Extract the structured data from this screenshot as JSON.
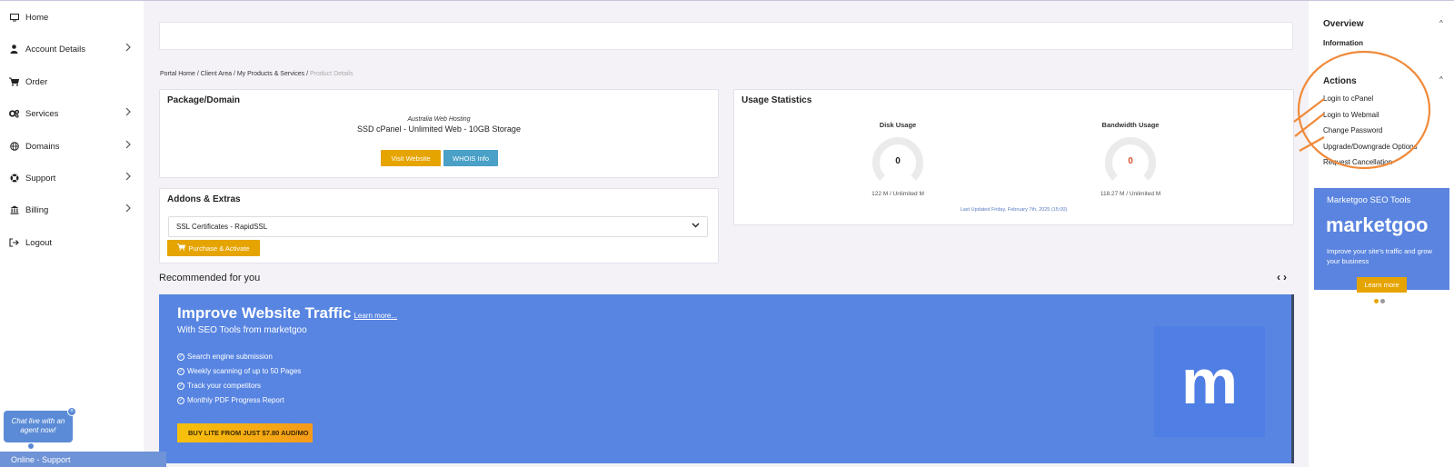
{
  "sidebar": {
    "items": [
      {
        "label": "Home",
        "icon": "monitor-icon",
        "has_chevron": false
      },
      {
        "label": "Account Details",
        "icon": "user-icon",
        "has_chevron": true
      },
      {
        "label": "Order",
        "icon": "cart-icon",
        "has_chevron": false
      },
      {
        "label": "Services",
        "icon": "cogs-icon",
        "has_chevron": true
      },
      {
        "label": "Domains",
        "icon": "globe-icon",
        "has_chevron": true
      },
      {
        "label": "Support",
        "icon": "lifebuoy-icon",
        "has_chevron": true
      },
      {
        "label": "Billing",
        "icon": "bank-icon",
        "has_chevron": true
      },
      {
        "label": "Logout",
        "icon": "logout-icon",
        "has_chevron": false
      }
    ]
  },
  "breadcrumb": {
    "items": [
      "Portal Home",
      "Client Area",
      "My Products & Services"
    ],
    "active": "Product Details",
    "separator": " / "
  },
  "package": {
    "title": "Package/Domain",
    "group": "Australia Web Hosting",
    "product": "SSD cPanel - Unlimited Web - 10GB Storage",
    "visit_label": "Visit Website",
    "whois_label": "WHOIS Info"
  },
  "addons": {
    "title": "Addons & Extras",
    "selected": "SSL Certificates - RapidSSL",
    "purchase_label": "Purchase & Activate"
  },
  "usage": {
    "title": "Usage Statistics",
    "disk_label": "Disk Usage",
    "disk_value": "0",
    "disk_foot": "122 M / Unlimited M",
    "bandwidth_label": "Bandwidth Usage",
    "bandwidth_value": "0",
    "bandwidth_foot": "118.27 M / Unlimited M",
    "updated": "Last Updated Friday, February 7th, 2025 (15:00)"
  },
  "recommended": {
    "title": "Recommended for you",
    "prev": "‹",
    "next": "›"
  },
  "banner": {
    "title": "Improve Website Traffic",
    "learn_more": "Learn more...",
    "subtitle": "With SEO Tools from marketgoo",
    "features": [
      "Search engine submission",
      "Weekly scanning of up to 50 Pages",
      "Track your competitors",
      "Monthly PDF Progress Report"
    ],
    "buy_label": "BUY LITE FROM JUST $7.80 AUD/MO",
    "logo_letter": "m"
  },
  "right": {
    "overview_title": "Overview",
    "information": "Information",
    "actions_title": "Actions",
    "actions": [
      "Login to cPanel",
      "Login to Webmail",
      "Change Password",
      "Upgrade/Downgrade Options",
      "Request Cancellation"
    ],
    "promo_title": "Marketgoo SEO Tools",
    "promo_logo": "marketgoo",
    "promo_text": "Improve your site's traffic and grow your business",
    "promo_button": "Learn more"
  },
  "chat": {
    "bubble": "Chat live with an agent now!",
    "close": "×",
    "status": "Online - Support"
  },
  "colors": {
    "accent_orange": "#e6a400",
    "whois_blue": "#4aa0c6",
    "banner_blue": "#5885e2",
    "annotation": "#f08a3a"
  }
}
